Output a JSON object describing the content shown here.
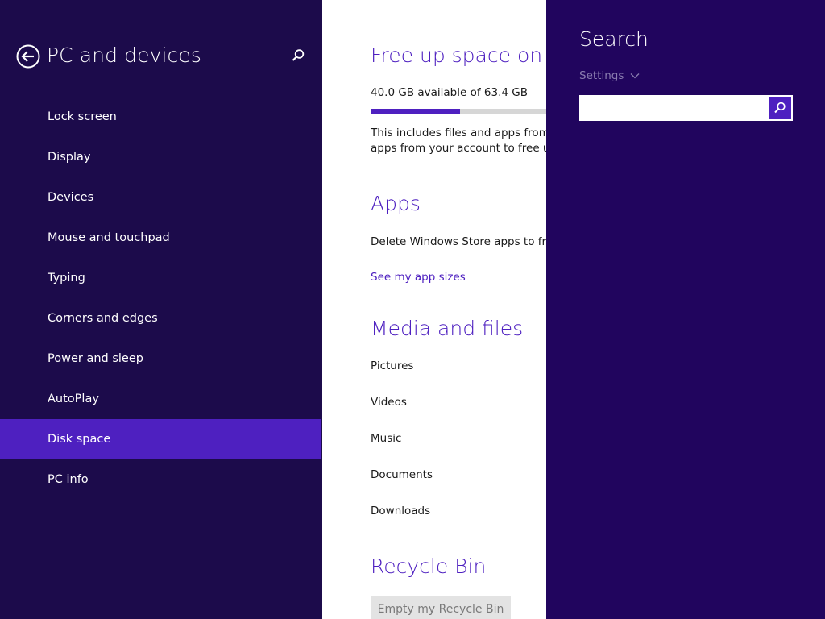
{
  "nav": {
    "title": "PC and devices",
    "items": [
      {
        "label": "Lock screen"
      },
      {
        "label": "Display"
      },
      {
        "label": "Devices"
      },
      {
        "label": "Mouse and touchpad"
      },
      {
        "label": "Typing"
      },
      {
        "label": "Corners and edges"
      },
      {
        "label": "Power and sleep"
      },
      {
        "label": "AutoPlay"
      },
      {
        "label": "Disk space",
        "selected": true
      },
      {
        "label": "PC info"
      }
    ]
  },
  "content": {
    "free_space": {
      "heading": "Free up space on th",
      "available_text": "40.0 GB available of 63.4 GB",
      "used_fraction": 0.37,
      "description_line1": "This includes files and apps from al",
      "description_line2": "apps from your account to free up"
    },
    "apps": {
      "heading": "Apps",
      "description": "Delete Windows Store apps to free",
      "link": "See my app sizes"
    },
    "media": {
      "heading": "Media and files",
      "items": [
        "Pictures",
        "Videos",
        "Music",
        "Documents",
        "Downloads"
      ]
    },
    "recycle": {
      "heading": "Recycle Bin",
      "button": "Empty my Recycle Bin"
    }
  },
  "charm": {
    "title": "Search",
    "scope": "Settings",
    "input_value": "",
    "placeholder": ""
  },
  "colors": {
    "nav_bg": "#1c0b4b",
    "charm_bg": "#21055e",
    "accent": "#4e20c0",
    "content_bg": "#ffffff"
  },
  "icons": {
    "back": "back-arrow-circle-icon",
    "search": "magnifier-icon",
    "scope_chevron": "chevron-down-icon"
  }
}
